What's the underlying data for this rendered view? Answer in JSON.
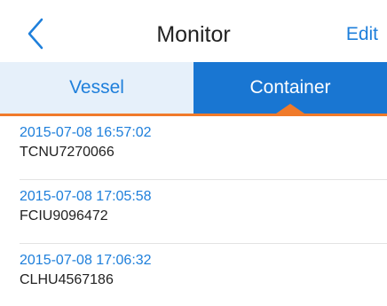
{
  "header": {
    "back_icon": "chevron-left-icon",
    "title": "Monitor",
    "edit_label": "Edit"
  },
  "tabs": [
    {
      "label": "Vessel",
      "selected": false
    },
    {
      "label": "Container",
      "selected": true
    }
  ],
  "items": [
    {
      "time": "2015-07-08 16:57:02",
      "code": "TCNU7270066"
    },
    {
      "time": "2015-07-08 17:05:58",
      "code": "FCIU9096472"
    },
    {
      "time": "2015-07-08 17:06:32",
      "code": "CLHU4567186"
    }
  ],
  "colors": {
    "accent": "#1e7fdb",
    "active_tab": "#1976d2",
    "indicator": "#f07a2a"
  }
}
